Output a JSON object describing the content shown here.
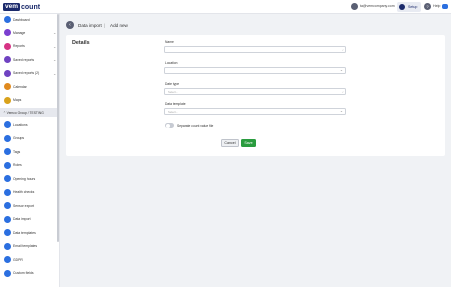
{
  "topbar": {
    "logo_vem": "vem",
    "logo_count": "count",
    "user_email": "ta@vemcompany.com",
    "setup_label": "Setup",
    "help_label": "Help"
  },
  "sidebar": {
    "items": [
      {
        "label": "Dashboard",
        "icon": "dashboard-icon"
      },
      {
        "label": "Manage",
        "icon": "manage-icon",
        "chevron": "⌄"
      },
      {
        "label": "Reports",
        "icon": "reports-icon",
        "chevron": "⌄"
      },
      {
        "label": "Saved reports",
        "icon": "saved-reports-icon",
        "chevron": "⌄"
      },
      {
        "label": "Saved reports (2)",
        "icon": "saved-reports-icon",
        "chevron": "⌄"
      },
      {
        "label": "Calendar",
        "icon": "calendar-icon"
      },
      {
        "label": "Maps",
        "icon": "maps-icon"
      }
    ],
    "group_label": "⌃ Vemco Group / TESTING",
    "sub_items": [
      {
        "label": "Locations",
        "icon": "location-icon"
      },
      {
        "label": "Groups",
        "icon": "groups-icon"
      },
      {
        "label": "Tags",
        "icon": "tag-icon"
      },
      {
        "label": "Roles",
        "icon": "roles-icon"
      },
      {
        "label": "Opening hours",
        "icon": "clock-icon"
      },
      {
        "label": "Health checks",
        "icon": "health-icon"
      },
      {
        "label": "Sensor export",
        "icon": "export-icon"
      },
      {
        "label": "Data import",
        "icon": "import-icon"
      },
      {
        "label": "Data templates",
        "icon": "template-icon"
      },
      {
        "label": "Email templates",
        "icon": "email-icon"
      },
      {
        "label": "GDPR",
        "icon": "shield-icon"
      },
      {
        "label": "Custom fields",
        "icon": "fields-icon"
      }
    ]
  },
  "breadcrumb": {
    "back": "‹",
    "current": "Data import",
    "separator": "|",
    "page": "Add new"
  },
  "form": {
    "title": "Details",
    "name_label": "Name",
    "name_value": "",
    "location_label": "Location",
    "location_placeholder": "",
    "date_type_label": "Date type",
    "date_type_placeholder": "Select...",
    "data_template_label": "Data template",
    "data_template_placeholder": "Select...",
    "toggle_label": "Separate count value file",
    "toggle_on": false
  },
  "actions": {
    "cancel": "Cancel",
    "save": "Save"
  },
  "colors": {
    "accent": "#2b6fe0",
    "brand": "#1b2a6b",
    "save": "#2a9c3f"
  }
}
